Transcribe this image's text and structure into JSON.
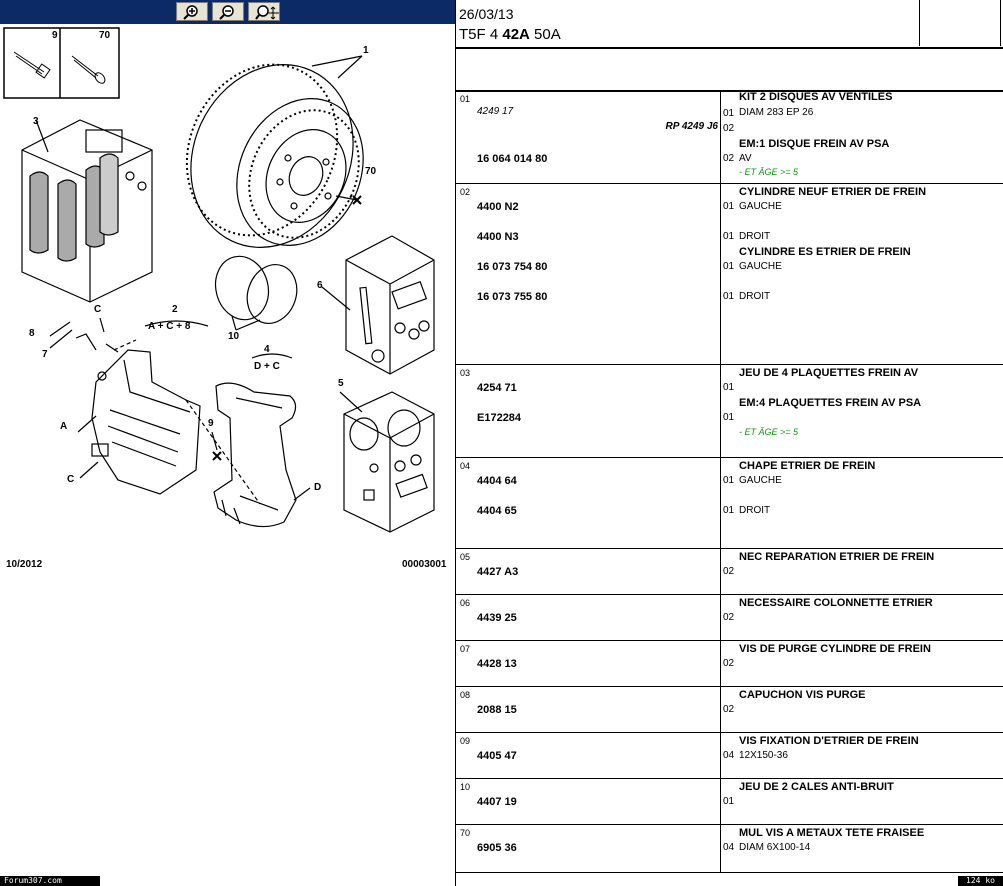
{
  "toolbar": {
    "zoom_in": "zoom-in-icon",
    "zoom_out": "zoom-out-icon",
    "zoom_pan": "zoom-pan-icon",
    "bg_color": "#0c2a66"
  },
  "diagram": {
    "date_code": "10/2012",
    "figure_code": "00003001",
    "labels": {
      "n9": "9",
      "n70": "70",
      "n1": "1",
      "n70b": "70",
      "n3": "3",
      "n6": "6",
      "n2": "2",
      "n2_sub": "A + C + 8",
      "n10": "10",
      "n4": "4",
      "n4_sub": "D + C",
      "n5": "5",
      "n8": "8",
      "n7": "7",
      "nC1": "C",
      "nA": "A",
      "n9b": "9",
      "nC2": "C",
      "nD": "D"
    }
  },
  "watermark": "Forum307.com",
  "file_size": "124 ko",
  "header": {
    "date": "26/03/13",
    "code_pre": "T5F 4 ",
    "code_bold": "42A",
    "code_post": " 50A"
  },
  "rows": [
    {
      "grp": "01",
      "items": [
        {
          "ref": "4249 17",
          "italic": true,
          "rp": "RP 4249 J6",
          "qty": "01",
          "desc": "KIT 2 DISQUES AV VENTILES",
          "sub": "DIAM 283 EP 26"
        },
        {
          "ref": "",
          "qty": "02",
          "desc": "EM:1 DISQUE FREIN AV PSA",
          "sub": ""
        },
        {
          "ref": "16 064 014 80",
          "qty": "02",
          "desc": "",
          "sub": "AV",
          "note": "- ET ÂGE >= 5"
        }
      ]
    },
    {
      "grp": "02",
      "items": [
        {
          "ref": "4400 N2",
          "qty": "01",
          "desc": "CYLINDRE NEUF ETRIER DE FREIN",
          "sub": "GAUCHE"
        },
        {
          "ref": "4400 N3",
          "qty": "01",
          "desc": "",
          "sub": "DROIT"
        },
        {
          "ref": "16 073 754 80",
          "qty": "01",
          "desc": "CYLINDRE ES ETRIER DE FREIN",
          "sub": "GAUCHE"
        },
        {
          "ref": "16 073 755 80",
          "qty": "01",
          "desc": "",
          "sub": "DROIT"
        }
      ]
    },
    {
      "grp": "03",
      "items": [
        {
          "ref": "4254 71",
          "qty": "01",
          "desc": "JEU DE 4 PLAQUETTES FREIN AV",
          "sub": ""
        },
        {
          "ref": "E172284",
          "qty": "01",
          "desc": "EM:4 PLAQUETTES FREIN AV PSA",
          "sub": "",
          "note": "- ET ÂGE >= 5"
        }
      ]
    },
    {
      "grp": "04",
      "items": [
        {
          "ref": "4404 64",
          "qty": "01",
          "desc": "CHAPE ETRIER DE FREIN",
          "sub": "GAUCHE"
        },
        {
          "ref": "4404 65",
          "qty": "01",
          "desc": "",
          "sub": "DROIT"
        }
      ]
    },
    {
      "grp": "05",
      "items": [
        {
          "ref": "4427 A3",
          "qty": "02",
          "desc": "NEC REPARATION ETRIER DE FREIN",
          "sub": ""
        }
      ]
    },
    {
      "grp": "06",
      "items": [
        {
          "ref": "4439 25",
          "qty": "02",
          "desc": "NECESSAIRE COLONNETTE ETRIER",
          "sub": ""
        }
      ]
    },
    {
      "grp": "07",
      "items": [
        {
          "ref": "4428 13",
          "qty": "02",
          "desc": "VIS DE PURGE CYLINDRE DE FREIN",
          "sub": ""
        }
      ]
    },
    {
      "grp": "08",
      "items": [
        {
          "ref": "2088 15",
          "qty": "02",
          "desc": "CAPUCHON VIS PURGE",
          "sub": ""
        }
      ]
    },
    {
      "grp": "09",
      "items": [
        {
          "ref": "4405 47",
          "qty": "04",
          "desc": "VIS FIXATION D'ETRIER DE FREIN",
          "sub": "12X150-36"
        }
      ]
    },
    {
      "grp": "10",
      "items": [
        {
          "ref": "4407 19",
          "qty": "01",
          "desc": "JEU DE 2 CALES ANTI-BRUIT",
          "sub": ""
        }
      ]
    },
    {
      "grp": "70",
      "items": [
        {
          "ref": "6905 36",
          "qty": "04",
          "desc": "MUL VIS A METAUX TETE FRAISEE",
          "sub": "DIAM 6X100-14"
        }
      ]
    }
  ]
}
